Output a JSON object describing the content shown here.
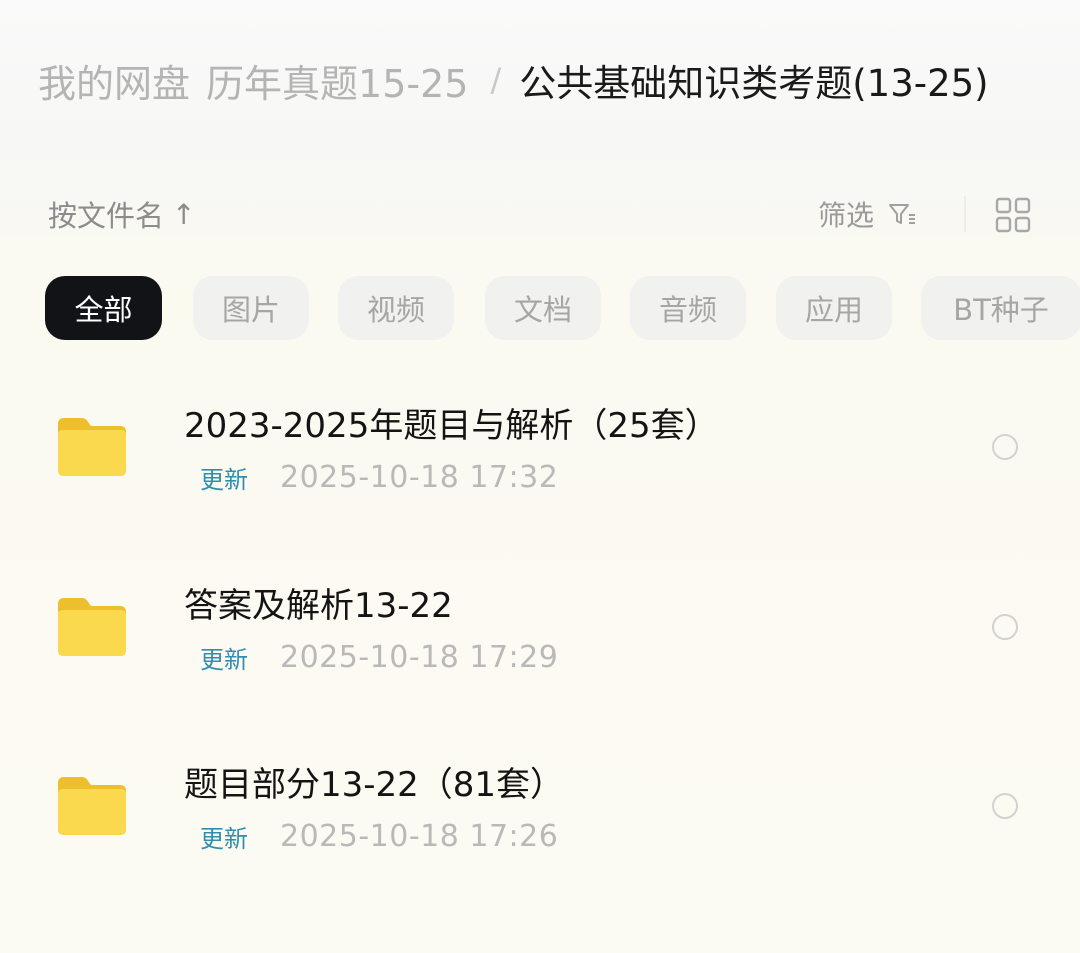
{
  "breadcrumb": {
    "root": "我的网盘",
    "parent": "历年真题15-25",
    "separator": "/",
    "current": "公共基础知识类考题(13-25)"
  },
  "toolbar": {
    "sort_label": "按文件名",
    "sort_arrow": "↑",
    "filter_label": "筛选",
    "filter_icon": "filter-icon",
    "view_icon": "grid-view-icon"
  },
  "categories": [
    {
      "label": "全部",
      "active": true
    },
    {
      "label": "图片",
      "active": false
    },
    {
      "label": "视频",
      "active": false
    },
    {
      "label": "文档",
      "active": false
    },
    {
      "label": "音频",
      "active": false
    },
    {
      "label": "应用",
      "active": false
    },
    {
      "label": "BT种子",
      "active": false
    }
  ],
  "files": [
    {
      "name": "2023-2025年题目与解析（25套）",
      "tag": "更新",
      "modified": "2025-10-18  17:32",
      "icon": "folder-icon"
    },
    {
      "name": "答案及解析13-22",
      "tag": "更新",
      "modified": "2025-10-18  17:29",
      "icon": "folder-icon"
    },
    {
      "name": "题目部分13-22（81套）",
      "tag": "更新",
      "modified": "2025-10-18  17:26",
      "icon": "folder-icon"
    }
  ],
  "colors": {
    "folder": "#f8d44a",
    "tag": "#2f8fb0",
    "active_chip": "#111317"
  }
}
